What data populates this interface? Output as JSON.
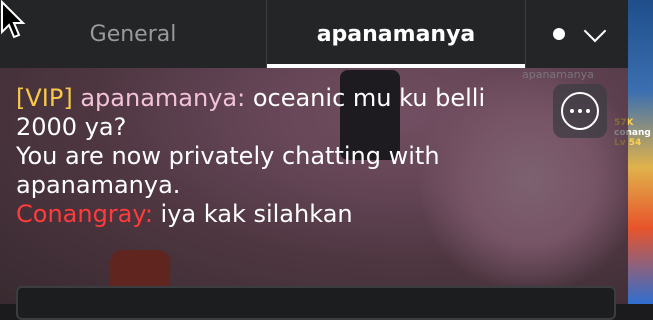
{
  "tabs": [
    {
      "label": "General"
    },
    {
      "label": "apanamanya"
    }
  ],
  "messages": [
    {
      "prefix": "[VIP]",
      "username": "apanamanya:",
      "text": " oceanic mu ku belli 2000 ya?"
    },
    {
      "system": "You are now privately chatting with apanamanya."
    },
    {
      "username": "Conangray:",
      "text": " iya kak silahkan"
    }
  ],
  "scene": {
    "nametag": "apanamanya",
    "side_tag_1": "57K",
    "side_tag_2": "conang",
    "side_tag_3": "Lv 54"
  },
  "icons": {
    "status_dot": "dot-icon",
    "menu": "chevron-down-icon",
    "chat_bubble": "chat-bubble-icon",
    "cursor": "mouse-cursor-icon"
  },
  "colors": {
    "vip": "#f7c84a",
    "sender_pink": "#f2c2d8",
    "sender_red": "#ff3b3b",
    "tabbar": "#232527"
  }
}
